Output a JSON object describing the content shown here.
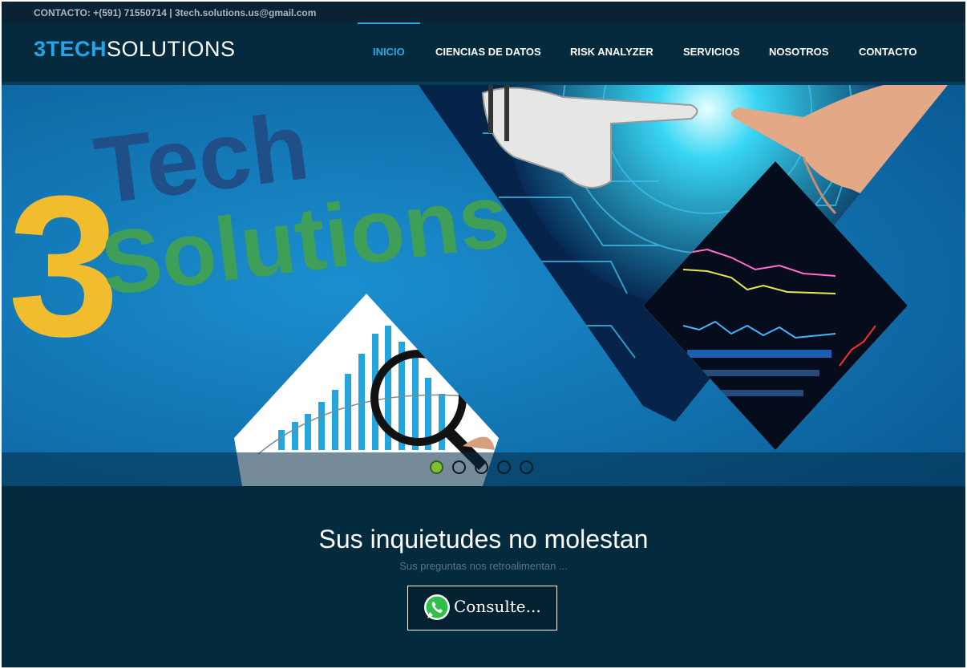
{
  "topbar": {
    "contact_text": "CONTACTO: +(591) 71550714 | 3tech.solutions.us@gmail.com"
  },
  "brand": {
    "part1": "3TECH",
    "part2": "SOLUTIONS",
    "accent_color": "#22a6e8"
  },
  "nav": {
    "items": [
      {
        "label": "INICIO",
        "active": true
      },
      {
        "label": "CIENCIAS DE DATOS"
      },
      {
        "label": "RISK ANALYZER"
      },
      {
        "label": "SERVICIOS"
      },
      {
        "label": "NOSOTROS"
      },
      {
        "label": "CONTACTO"
      }
    ]
  },
  "hero": {
    "slide_text": {
      "digit": "3",
      "word1": "Tech",
      "word2": "Solutions"
    },
    "carousel": {
      "slide_count": 5,
      "active_index": 0
    },
    "colors": {
      "digit": "#f1bc2e",
      "tech": "#1f4f86",
      "solutions": "#3f9e58",
      "active_dot": "#7ac231"
    }
  },
  "cta": {
    "title": "Sus inquietudes no molestan",
    "subtitle": "Sus preguntas nos retroalimentan ...",
    "button_label": "Consulte...",
    "button_icon": "whatsapp-icon"
  }
}
